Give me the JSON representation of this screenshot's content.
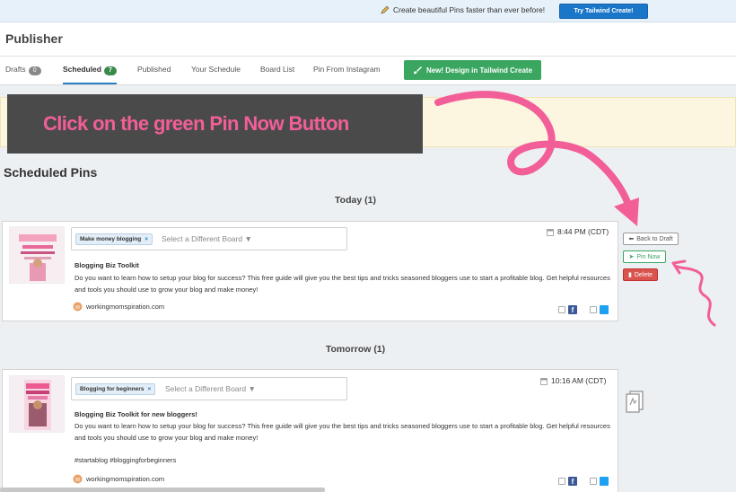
{
  "topbar": {
    "promo_text": "Create beautiful Pins faster than ever before!",
    "try_button": "Try Tailwind Create!"
  },
  "header": {
    "title": "Publisher"
  },
  "tabs": [
    {
      "label": "Drafts",
      "count": "0"
    },
    {
      "label": "Scheduled",
      "count": "7"
    },
    {
      "label": "Published"
    },
    {
      "label": "Your Schedule"
    },
    {
      "label": "Board List"
    },
    {
      "label": "Pin From Instagram"
    }
  ],
  "design_button": "New! Design in Tailwind Create",
  "overlay_text": "Click on the green Pin Now Button",
  "section_title": "Scheduled Pins",
  "days": [
    "Today (1)",
    "Tomorrow (1)"
  ],
  "pins": [
    {
      "board": "Make money blogging",
      "board_placeholder": "Select a Different Board",
      "time": "8:44 PM (CDT)",
      "title": "Blogging Biz Toolkit",
      "description": "Do you want to learn how to setup your blog for success? This free guide will give you the best tips and tricks seasoned bloggers use to start a profitable blog. Get helpful resources and tools you should use to grow your blog and make money!",
      "site": "workingmomspiration.com"
    },
    {
      "board": "Blogging for beginners",
      "board_placeholder": "Select a Different Board",
      "time": "10:16 AM (CDT)",
      "title": "Blogging Biz Toolkit for new bloggers!",
      "description": "Do you want to learn how to setup your blog for success? This free guide will give you the best tips and tricks seasoned bloggers use to start a profitable blog. Get helpful resources and tools you should use to grow your blog and make money!",
      "hashtags": "#startablog #bloggingforbeginners",
      "site": "workingmomspiration.com"
    }
  ],
  "actions": {
    "back_to_draft": "Back to Draft",
    "pin_now": "Pin Now",
    "delete": "Delete"
  },
  "colors": {
    "accent_blue": "#1976c9",
    "pin_now_green": "#3aa660",
    "delete_red": "#d9534f",
    "annotation_pink": "#f25f98"
  }
}
